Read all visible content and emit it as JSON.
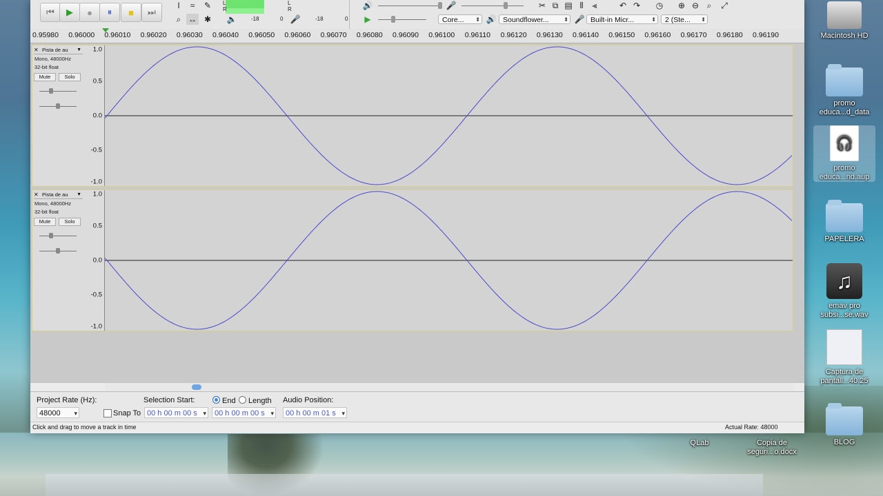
{
  "toolbar": {
    "meter_labels": {
      "l": "L",
      "r": "R",
      "neg18_a": "-18",
      "zero_a": "0",
      "neg18_b": "-18",
      "zero_b": "0"
    },
    "playback_device": "Core...",
    "output_device": "Soundflower...",
    "input_device": "Built-in Micr...",
    "channels": "2 (Ste..."
  },
  "ruler": {
    "labels": [
      "0.95980",
      "0.96000",
      "0.96010",
      "0.96020",
      "0.96030",
      "0.96040",
      "0.96050",
      "0.96060",
      "0.96070",
      "0.96080",
      "0.96090",
      "0.96100",
      "0.96110",
      "0.96120",
      "0.96130",
      "0.96140",
      "0.96150",
      "0.96160",
      "0.96170",
      "0.96180",
      "0.96190"
    ]
  },
  "tracks": [
    {
      "name": "Pista de au",
      "format": "Mono, 48000Hz",
      "bits": "32-bit float",
      "mute": "Mute",
      "solo": "Solo",
      "scale": [
        "1.0",
        "0.5",
        "0.0",
        "-0.5",
        "-1.0"
      ],
      "phase": "sine"
    },
    {
      "name": "Pista de au",
      "format": "Mono, 48000Hz",
      "bits": "32-bit float",
      "mute": "Mute",
      "solo": "Solo",
      "scale": [
        "1.0",
        "0.5",
        "0.0",
        "-0.5",
        "-1.0"
      ],
      "phase": "inverted"
    }
  ],
  "selection": {
    "project_rate_label": "Project Rate (Hz):",
    "project_rate": "48000",
    "selection_start_label": "Selection Start:",
    "end_label": "End",
    "length_label": "Length",
    "audio_position_label": "Audio Position:",
    "snap_to_label": "Snap To",
    "start_time": "00 h 00 m 00 s",
    "end_time": "00 h 00 m 00 s",
    "audio_position": "00 h 00 m 01 s"
  },
  "status": {
    "message": "Click and drag to move a track in time",
    "actual_rate": "Actual Rate: 48000"
  },
  "desktop": {
    "icons": [
      {
        "label": "Macintosh HD",
        "kind": "hd-icon"
      },
      {
        "label": "promo educa...d_data",
        "kind": "folder-icon"
      },
      {
        "label": "promo educa...nd.aup",
        "kind": "audacity-doc-icon"
      },
      {
        "label": "PAPELERA",
        "kind": "folder-icon"
      },
      {
        "label": "emav pro subsi...se.wav",
        "kind": "music-icon"
      },
      {
        "label": "Captura de pantall...40.25",
        "kind": "screenshot-icon"
      },
      {
        "label": "BLOG",
        "kind": "folder-icon"
      },
      {
        "label": "QLab",
        "kind": "text"
      },
      {
        "label": "Copia de seguri...o.docx",
        "kind": "text"
      }
    ]
  },
  "colors": {
    "waveform": "#4a4acb",
    "selection_border": "#d7d08a",
    "meter_green": "#6fe36f"
  }
}
